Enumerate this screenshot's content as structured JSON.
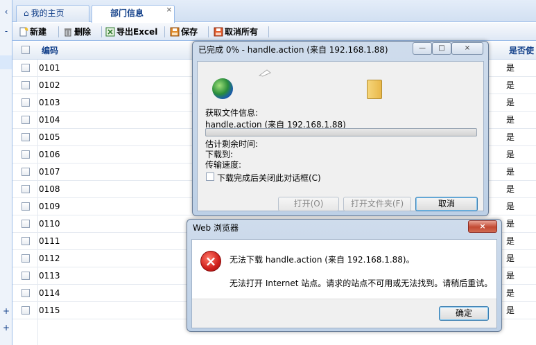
{
  "left_strip": {
    "top_arrow": "‹",
    "top_button": "-",
    "bottom_button_1": "+",
    "bottom_button_2": "+"
  },
  "tabs": [
    {
      "label": "我的主页",
      "active": false
    },
    {
      "label": "部门信息",
      "active": true,
      "close": "×"
    }
  ],
  "toolbar": {
    "new_label": "新建",
    "delete_label": "删除",
    "export_label": "导出Excel",
    "save_label": "保存",
    "cancel_all_label": "取消所有"
  },
  "grid": {
    "columns": [
      "编码",
      "是否使"
    ],
    "rows": [
      {
        "code": "0101",
        "flag": "是"
      },
      {
        "code": "0102",
        "flag": "是"
      },
      {
        "code": "0103",
        "flag": "是"
      },
      {
        "code": "0104",
        "flag": "是"
      },
      {
        "code": "0105",
        "flag": "是"
      },
      {
        "code": "0106",
        "flag": "是"
      },
      {
        "code": "0107",
        "flag": "是"
      },
      {
        "code": "0108",
        "flag": "是"
      },
      {
        "code": "0109",
        "flag": "是"
      },
      {
        "code": "0110",
        "flag": "是"
      },
      {
        "code": "0111",
        "flag": "是"
      },
      {
        "code": "0112",
        "flag": "是"
      },
      {
        "code": "0113",
        "flag": "是"
      },
      {
        "code": "0114",
        "flag": "是"
      },
      {
        "code": "0115",
        "flag": "是"
      }
    ]
  },
  "download_dialog": {
    "title": "已完成 0% - handle.action (来自 192.168.1.88)",
    "get_file_info": "获取文件信息:",
    "file_name": "handle.action (来自 192.168.1.88)",
    "progress": 0,
    "time_left_label": "估计剩余时间:",
    "download_to_label": "下载到:",
    "transfer_rate_label": "传输速度:",
    "close_on_complete": "下载完成后关闭此对话框(C)",
    "open_button": "打开(O)",
    "open_folder_button": "打开文件夹(F)",
    "cancel_button": "取消"
  },
  "error_dialog": {
    "title": "Web 浏览器",
    "close": "×",
    "message_1": "无法下载 handle.action (来自 192.168.1.88)。",
    "message_2": "无法打开 Internet 站点。请求的站点不可用或无法找到。请稍后重试。",
    "ok_button": "确定"
  },
  "colors": {
    "accent": "#15428b",
    "border": "#99bbe8",
    "error": "#d0201c"
  }
}
